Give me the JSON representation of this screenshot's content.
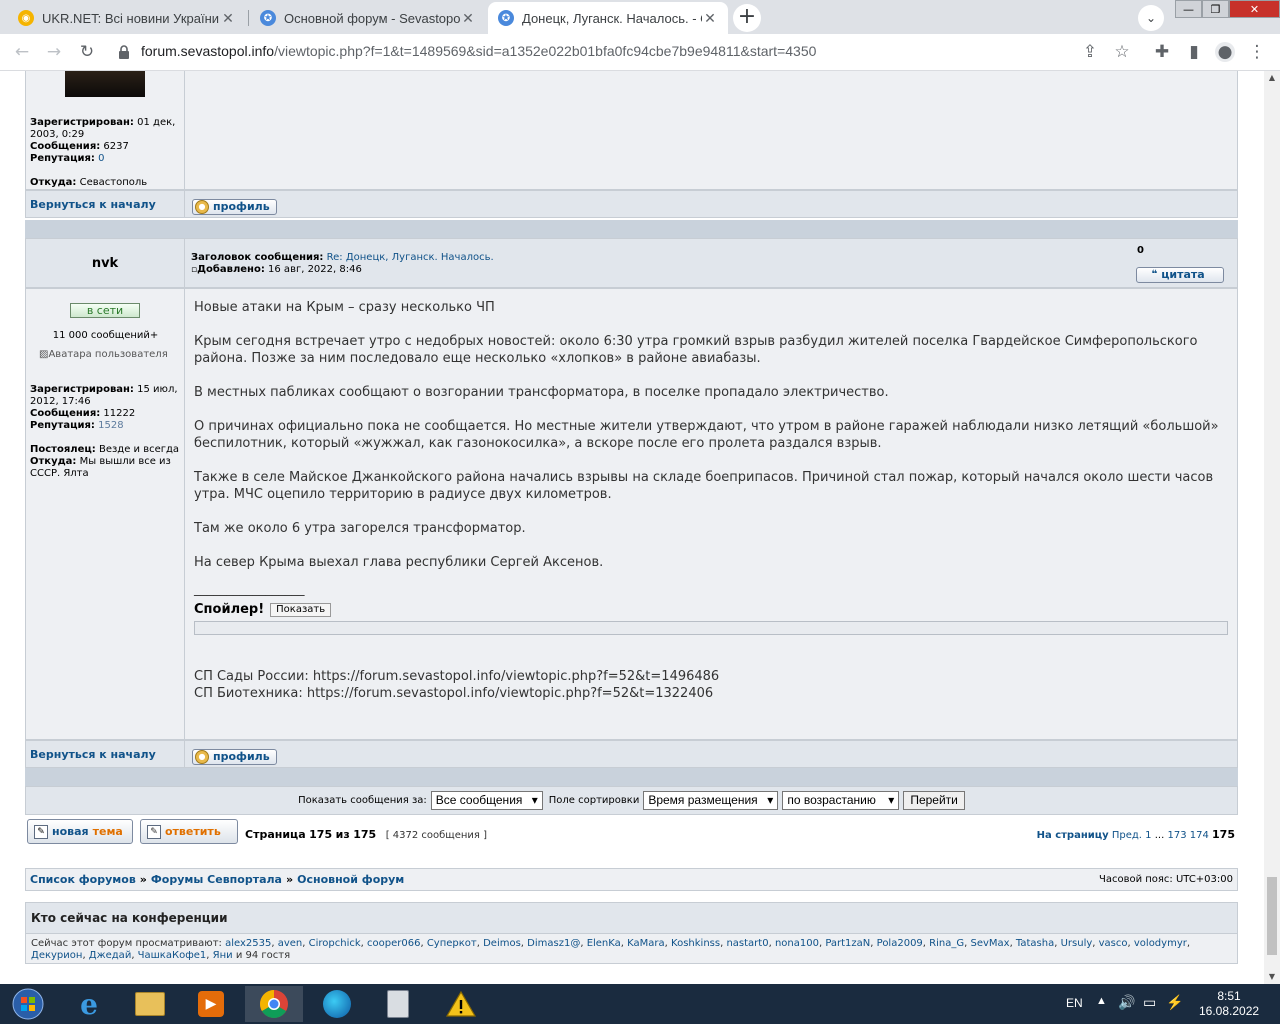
{
  "browser": {
    "tabs": [
      {
        "title": "UKR.NET: Всі новини України, ос",
        "favicon": "ukr-icon"
      },
      {
        "title": "Основной форум - Sevastopol.in",
        "favicon": "sevastopol-icon"
      },
      {
        "title": "Донецк, Луганск. Началось. - Ст",
        "favicon": "sevastopol-icon",
        "active": true
      }
    ],
    "new_tab": "+",
    "url_host": "forum.sevastopol.info",
    "url_path": "/viewtopic.php?f=1&t=1489569&sid=a1352e022b01bfa0fc94cbe7b9e94811&start=4350"
  },
  "prev_post": {
    "registered_label": "Зарегистрирован:",
    "registered_value": "01 дек, 2003, 0:29",
    "posts_label": "Сообщения:",
    "posts_value": "6237",
    "rep_label": "Репутация:",
    "rep_value": "0",
    "from_label": "Откуда:",
    "from_value": "Севастополь",
    "back_to_top": "Вернуться к началу",
    "profile_btn": "профиль"
  },
  "post": {
    "author": "nvk",
    "subject_label": "Заголовок сообщения:",
    "subject_value": "Re: Донецк, Луганск. Началось.",
    "added_label": "Добавлено:",
    "added_value": "16 авг, 2022, 8:46",
    "rating": "0",
    "quote_btn": "цитата",
    "online_badge": "в сети",
    "post_count_rank": "11 000 сообщений+",
    "avatar_alt": "Аватара пользователя",
    "registered_label": "Зарегистрирован:",
    "registered_value": "15 июл, 2012, 17:46",
    "posts_label": "Сообщения:",
    "posts_value": "11222",
    "rep_label": "Репутация:",
    "rep_value": "1528",
    "regular_label": "Постоялец:",
    "regular_value": "Везде и всегда",
    "from_label": "Откуда:",
    "from_value": "Мы вышли все из СССР. Ялта",
    "body": [
      "Новые атаки на Крым – сразу несколько ЧП",
      "Крым сегодня встречает утро с недобрых новостей: около 6:30 утра громкий взрыв разбудил жителей поселка Гвардейское Симферопольского района. Позже за ним последовало еще несколько «хлопков» в районе авиабазы.",
      "В местных пабликах сообщают о возгорании трансформатора, в поселке пропадало электричество.",
      "О причинах официально пока не сообщается. Но местные жители утверждают, что утром в районе гаражей наблюдали низко летящий «большой» беспилотник, который «жужжал, как газонокосилка», а вскоре после его пролета раздался взрыв.",
      "Также в селе Майское Джанкойского района начались взрывы на складе боеприпасов. Причиной стал пожар, который начался около шести часов утра. МЧС оцепило территорию в радиусе двух километров.",
      "Там же около 6 утра загорелся трансформатор.",
      "На север Крыма выехал глава республики Сергей Аксенов."
    ],
    "sig_line": "_________________",
    "spoiler_label": "Спойлер!",
    "spoiler_btn": "Показать",
    "sig_line1": "СП Сады России: https://forum.sevastopol.info/viewtopic.php?f=52&t=1496486",
    "sig_line2": "СП Биотехника: https://forum.sevastopol.info/viewtopic.php?f=52&t=1322406",
    "back_to_top": "Вернуться к началу",
    "profile_btn": "профиль"
  },
  "sort_bar": {
    "show_label": "Показать сообщения за:",
    "show_value": "Все сообщения",
    "sort_label": "Поле сортировки",
    "sort_value": "Время размещения",
    "order_value": "по возрастанию",
    "go_btn": "Перейти"
  },
  "pagination": {
    "new_topic_a": "новая",
    "new_topic_b": "тема",
    "reply_btn": "ответить",
    "page_label": "Страница",
    "page_cur": "175",
    "page_of": "из",
    "page_total": "175",
    "msg_count": "[ 4372 сообщения ]",
    "to_page": "На страницу",
    "prev": "Пред.",
    "p1": "1",
    "ellipsis": "...",
    "p173": "173",
    "p174": "174",
    "p175": "175"
  },
  "breadcrumb": {
    "item1": "Список форумов",
    "item2": "Форумы Севпортала",
    "item3": "Основной форум",
    "sep": "»",
    "timezone": "Часовой пояс: UTC+03:00"
  },
  "online": {
    "title": "Кто сейчас на конференции",
    "prefix": "Сейчас этот форум просматривают:",
    "users": [
      "alex2535",
      "aven",
      "Ciropchick",
      "cooper066",
      "Суперкот",
      "Deimos",
      "Dimasz1@",
      "ElenKa",
      "KaMara",
      "Koshkinss",
      "nastart0",
      "nona100",
      "Part1zaN",
      "Pola2009",
      "Rina_G",
      "SevMax",
      "Tatasha",
      "Ursuly",
      "vasco",
      "volodymyr",
      "Декурион",
      "Джедай",
      "ЧашкаКофе1",
      "Яни"
    ],
    "suffix": "и 94 гостя"
  },
  "taskbar": {
    "lang": "EN",
    "time": "8:51",
    "date": "16.08.2022"
  }
}
